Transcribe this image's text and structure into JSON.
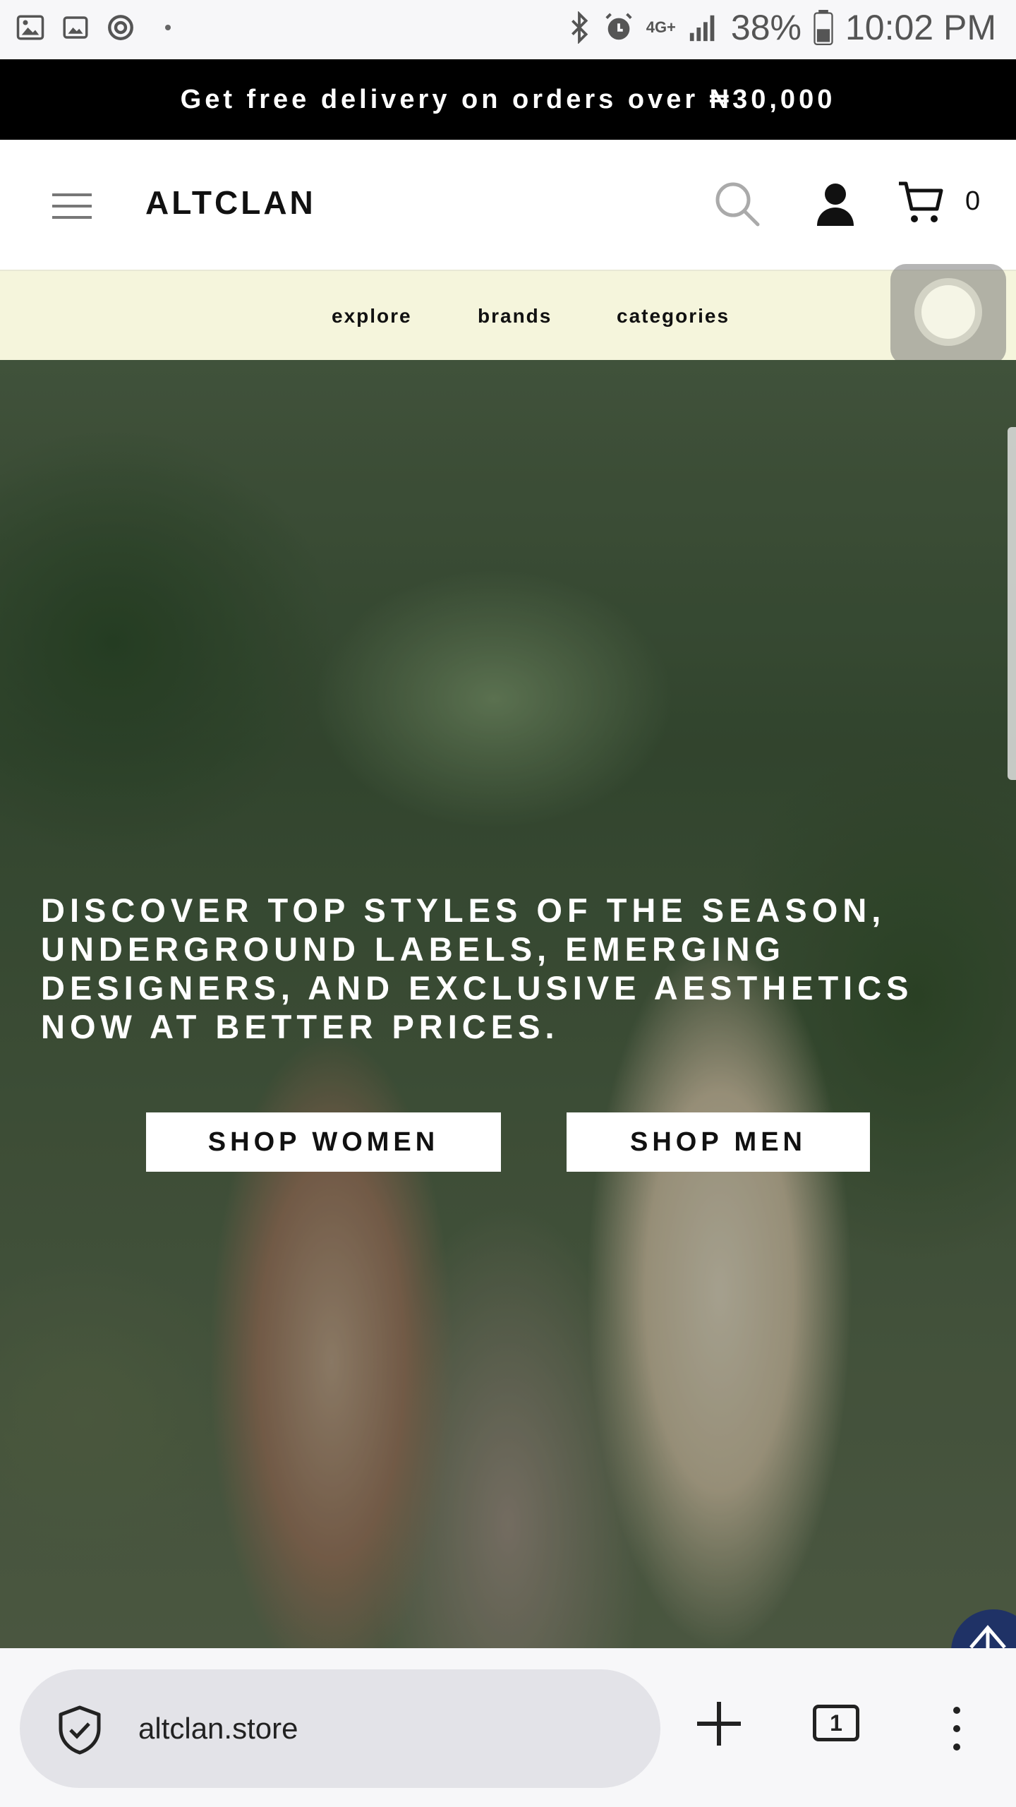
{
  "status_bar": {
    "battery": "38%",
    "time": "10:02 PM",
    "network": "4G+"
  },
  "promo": {
    "text": "Get free delivery on orders over ₦30,000"
  },
  "header": {
    "brand": "ALTCLAN",
    "cart_count": "0"
  },
  "nav": {
    "items": [
      {
        "label": "explore"
      },
      {
        "label": "brands"
      },
      {
        "label": "categories"
      }
    ]
  },
  "hero": {
    "headline": "DISCOVER TOP STYLES OF THE SEASON, UNDERGROUND LABELS, EMERGING DESIGNERS, AND EXCLUSIVE AESTHETICS NOW AT BETTER PRICES.",
    "buttons": {
      "women": "SHOP WOMEN",
      "men": "SHOP MEN"
    }
  },
  "browser": {
    "url": "altclan.store",
    "tab_count": "1"
  },
  "colors": {
    "promo_bg": "#000000",
    "nav_bg": "#f5f5dc",
    "accent": "#1f3266"
  }
}
